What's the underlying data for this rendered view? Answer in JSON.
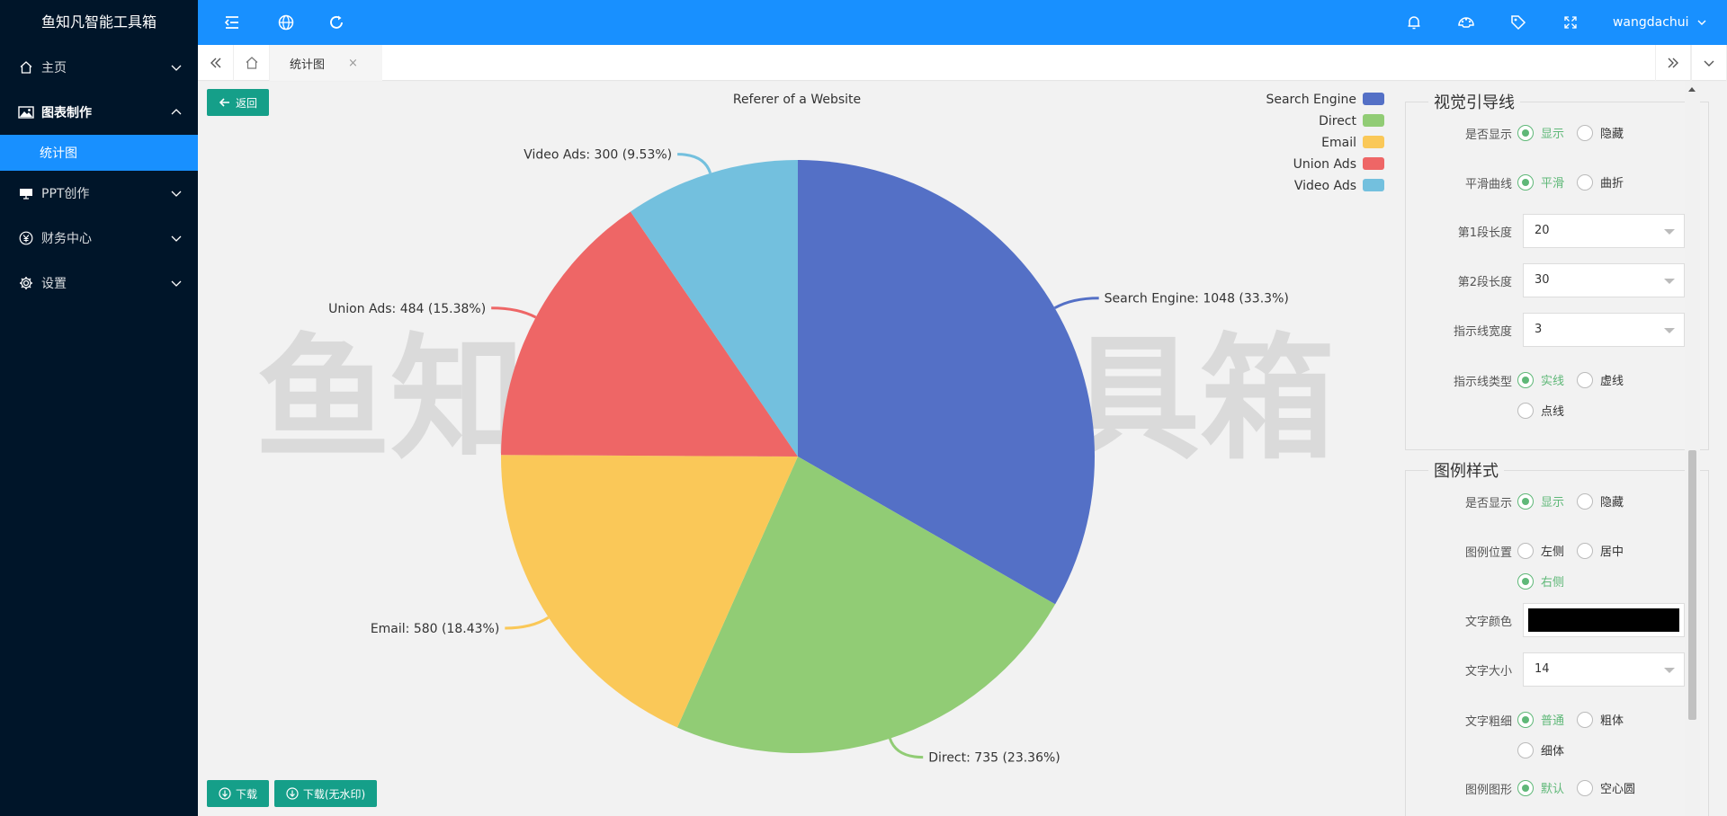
{
  "app": {
    "logo": "鱼知凡智能工具箱",
    "username": "wangdachui"
  },
  "sidebar": {
    "items": [
      {
        "label": "主页",
        "icon": "home-icon"
      },
      {
        "label": "图表制作",
        "icon": "image-icon",
        "sub": "统计图"
      },
      {
        "label": "PPT创作",
        "icon": "projector-icon"
      },
      {
        "label": "财务中心",
        "icon": "yen-icon"
      },
      {
        "label": "设置",
        "icon": "gear-icon"
      }
    ]
  },
  "tabs": {
    "active": "统计图",
    "close": "×"
  },
  "toolbar": {
    "back": "返回",
    "download": "下载",
    "download_nowm": "下载(无水印)"
  },
  "watermark": "鱼知凡智能工具箱",
  "chart_data": {
    "type": "pie",
    "title": "Referer of a Website",
    "categories": [
      "Search Engine",
      "Direct",
      "Email",
      "Union Ads",
      "Video Ads"
    ],
    "values": [
      1048,
      735,
      580,
      484,
      300
    ],
    "percent_labels": [
      "33.3%",
      "23.36%",
      "18.43%",
      "15.38%",
      "9.53%"
    ],
    "colors": [
      "#5470c6",
      "#91cc75",
      "#fac858",
      "#ee6666",
      "#73c0de"
    ],
    "legend_position": "top-right",
    "data_labels": [
      "Search Engine: 1048 (33.3%)",
      "Direct: 735 (23.36%)",
      "Email: 580 (18.43%)",
      "Union Ads: 484 (15.38%)",
      "Video Ads: 300 (9.53%)"
    ]
  },
  "panel": {
    "guide": {
      "title": "视觉引导线",
      "show_label": "是否显示",
      "show_on": "显示",
      "show_off": "隐藏",
      "smooth_label": "平滑曲线",
      "smooth_on": "平滑",
      "smooth_off": "曲折",
      "len1_label": "第1段长度",
      "len1_value": "20",
      "len2_label": "第2段长度",
      "len2_value": "30",
      "width_label": "指示线宽度",
      "width_value": "3",
      "type_label": "指示线类型",
      "type_solid": "实线",
      "type_dashed": "虚线",
      "type_dotted": "点线"
    },
    "legend": {
      "title": "图例样式",
      "show_label": "是否显示",
      "show_on": "显示",
      "show_off": "隐藏",
      "pos_label": "图例位置",
      "pos_left": "左侧",
      "pos_center": "居中",
      "pos_right": "右侧",
      "color_label": "文字颜色",
      "color_value": "#000000",
      "size_label": "文字大小",
      "size_value": "14",
      "weight_label": "文字粗细",
      "weight_normal": "普通",
      "weight_bold": "粗体",
      "weight_light": "细体",
      "shape_label": "图例图形",
      "shape_default": "默认",
      "shape_hollow": "空心圆"
    }
  }
}
